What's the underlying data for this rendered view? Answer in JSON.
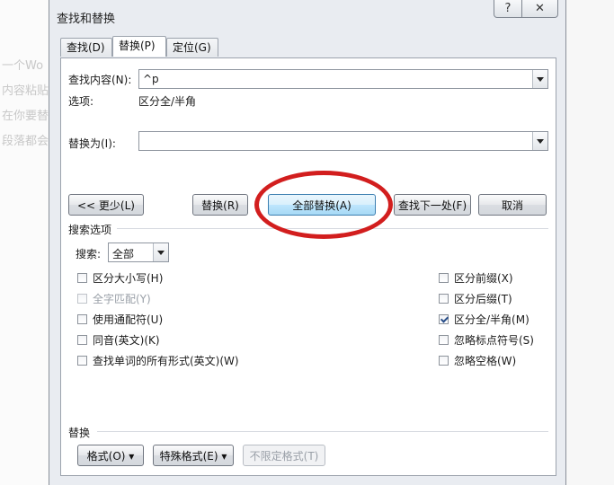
{
  "background": {
    "lines": [
      "一个Wo",
      "内容粘贴",
      "在你要替",
      "段落都会"
    ]
  },
  "dialog": {
    "title": "查找和替换",
    "help_label": "?",
    "close_label": "✕",
    "tabs": [
      {
        "label": "查找(D)",
        "active": false
      },
      {
        "label": "替换(P)",
        "active": true
      },
      {
        "label": "定位(G)",
        "active": false
      }
    ],
    "find": {
      "label": "查找内容(N):",
      "value": "^p",
      "options_label": "选项:",
      "options_value": "区分全/半角"
    },
    "replace": {
      "label": "替换为(I):",
      "value": ""
    },
    "buttons": {
      "less": "<< 更少(L)",
      "replace": "替换(R)",
      "replace_all": "全部替换(A)",
      "find_next": "查找下一处(F)",
      "cancel": "取消"
    },
    "search_options": {
      "heading": "搜索选项",
      "search_label": "搜索:",
      "search_value": "全部",
      "left_checks": [
        {
          "label": "区分大小写(H)",
          "checked": false,
          "disabled": false
        },
        {
          "label": "全字匹配(Y)",
          "checked": false,
          "disabled": true
        },
        {
          "label": "使用通配符(U)",
          "checked": false,
          "disabled": false
        },
        {
          "label": "同音(英文)(K)",
          "checked": false,
          "disabled": false
        },
        {
          "label": "查找单词的所有形式(英文)(W)",
          "checked": false,
          "disabled": false
        }
      ],
      "right_checks": [
        {
          "label": "区分前缀(X)",
          "checked": false,
          "disabled": false
        },
        {
          "label": "区分后缀(T)",
          "checked": false,
          "disabled": false
        },
        {
          "label": "区分全/半角(M)",
          "checked": true,
          "disabled": false
        },
        {
          "label": "忽略标点符号(S)",
          "checked": false,
          "disabled": false
        },
        {
          "label": "忽略空格(W)",
          "checked": false,
          "disabled": false
        }
      ]
    },
    "replace_section": {
      "heading": "替换",
      "format_label": "格式(O) ▾",
      "special_label": "特殊格式(E) ▾",
      "no_format_label": "不限定格式(T)"
    }
  },
  "colors": {
    "highlight_ring": "#d21e1e",
    "dialog_bg": "#e9ecf1",
    "primary_button": "#bee6fd"
  }
}
